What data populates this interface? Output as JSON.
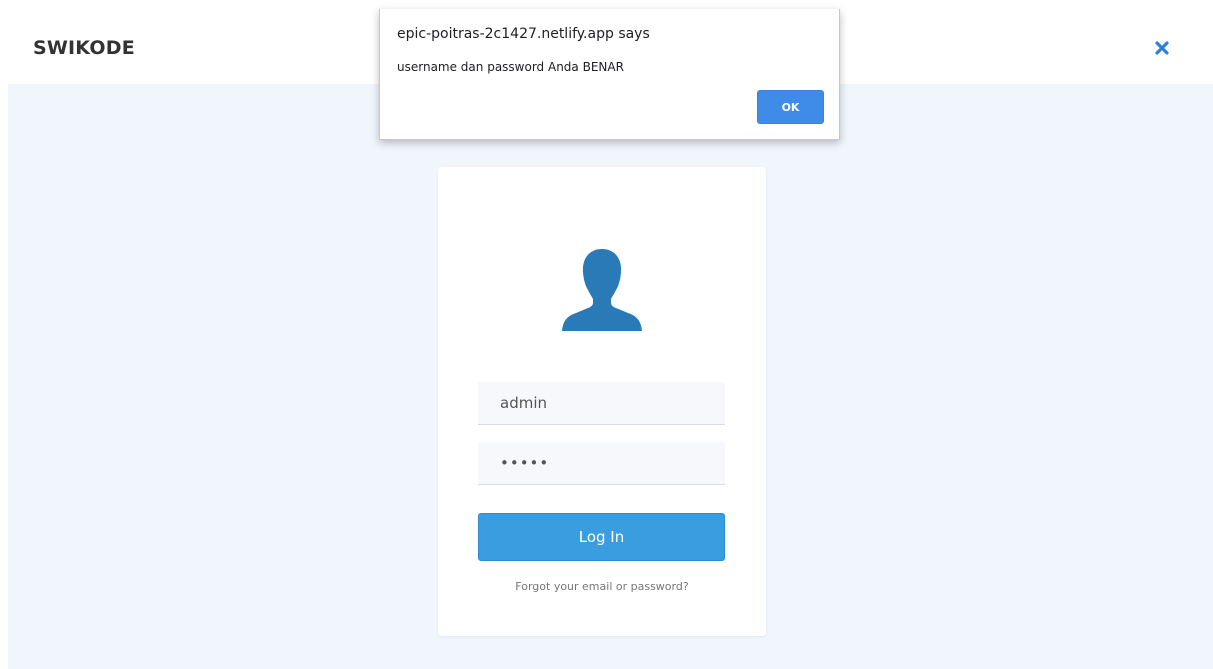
{
  "header": {
    "brand": "SWIKODE",
    "close_icon": "close-icon",
    "accent_color": "#2f7ed8"
  },
  "login": {
    "username_value": "admin",
    "password_value": "admin",
    "button_label": "Log In",
    "forgot_link": "Forgot your email or password?",
    "avatar_icon": "user-silhouette-icon",
    "avatar_color": "#2a7ab8",
    "button_color": "#3a9ddf"
  },
  "alert": {
    "title": "epic-poitras-2c1427.netlify.app says",
    "message": "username dan password Anda BENAR",
    "ok_label": "OK",
    "ok_color": "#3e8be8"
  }
}
